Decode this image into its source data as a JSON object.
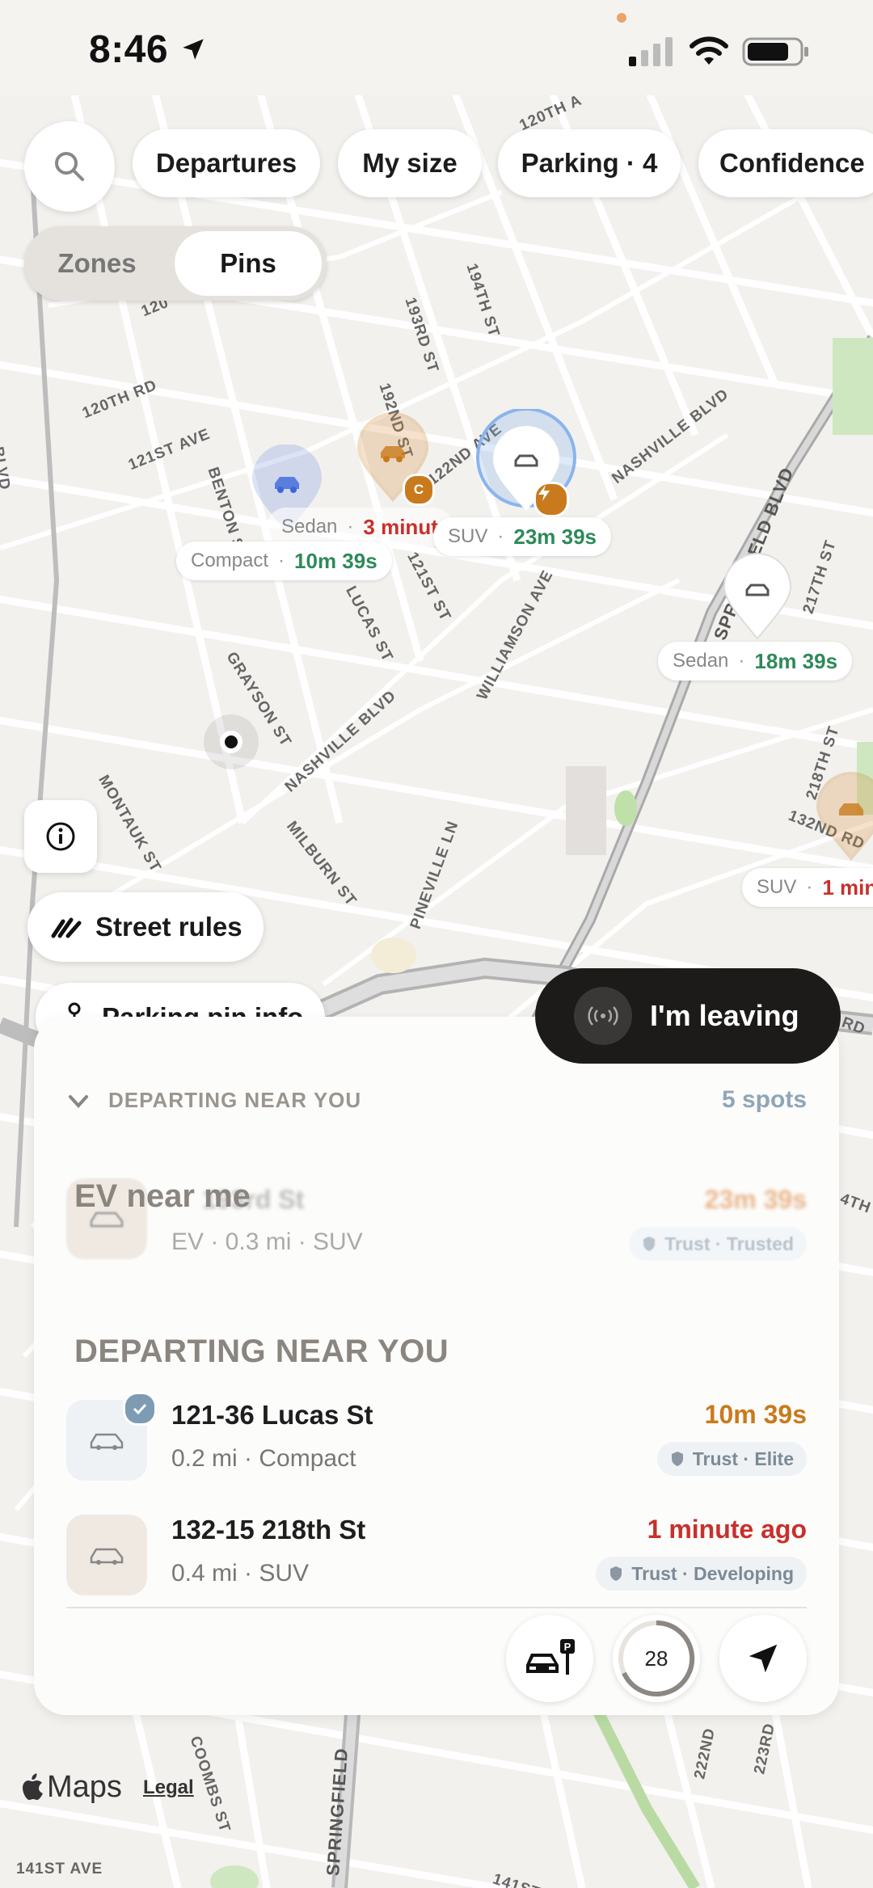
{
  "status_bar": {
    "time": "8:46"
  },
  "filters": {
    "departures": "Departures",
    "my_size": "My size",
    "parking": "Parking · 4",
    "confidence": "Confidence"
  },
  "view_toggle": {
    "zones": "Zones",
    "pins": "Pins",
    "selected": "Pins"
  },
  "streets": {
    "s1": "120TH RD",
    "s2": "121ST AVE",
    "s3": "BENTON ST",
    "s4": "193RD ST",
    "s5": "194TH ST",
    "s6": "192ND ST",
    "s7": "122ND AVE",
    "s8": "NASHVILLE BLVD",
    "s9": "SPRINGFIELD BLVD",
    "s10": "217TH ST",
    "s11": "LUCAS ST",
    "s12": "121ST ST",
    "s13": "WILLIAMSON AVE",
    "s14": "GRAYSON ST",
    "s15": "NASHVILLE BLVD",
    "s16": "MONTAUK ST",
    "s17": "MILBURN ST",
    "s18": "PINEVILLE LN",
    "s19": "218TH ST",
    "s20": "132ND RD",
    "s21": "120TH A",
    "s22": "141ST AVE",
    "s23": "COOMBS ST",
    "s24": "SPRINGFIELD",
    "s25": "222ND",
    "s26": "223RD",
    "s27": "141ST",
    "s28": "BLVD",
    "s29": "120",
    "s30": "RD",
    "s31": "4TH"
  },
  "pins": [
    {
      "vehicle": "Sedan",
      "time": "3 minut",
      "color": "#c8302c"
    },
    {
      "vehicle": "Compact",
      "time": "10m 39s",
      "color": "#2e8a5a"
    },
    {
      "vehicle": "SUV",
      "time": "23m 39s",
      "color": "#2e8a5a"
    },
    {
      "vehicle": "Sedan",
      "time": "18m 39s",
      "color": "#2e8a5a"
    },
    {
      "vehicle": "SUV",
      "time": "1 min",
      "color": "#c8302c"
    }
  ],
  "pin_badges": {
    "c_badge": "C"
  },
  "buttons": {
    "street_rules": "Street rules",
    "parking_pin_info": "Parking pin info",
    "leaving": "I'm leaving"
  },
  "sheet": {
    "section_header": "DEPARTING NEAR YOU",
    "spots": "5 spots",
    "ev_title": "EV near me",
    "ev_address_partial": "193rd St",
    "ev_time": "23m 39s",
    "ev_meta": "EV · 0.3 mi · SUV",
    "ev_trust": "Trust · Trusted",
    "list_header": "DEPARTING NEAR YOU",
    "items": [
      {
        "address": "121-36 Lucas St",
        "meta": "0.2 mi · Compact",
        "time": "10m 39s",
        "time_color": "#c97a1c",
        "trust": "Trust · Elite"
      },
      {
        "address": "132-15 218th St",
        "meta": "0.4 mi · SUV",
        "time": "1 minute ago",
        "time_color": "#c8302c",
        "trust": "Trust · Developing"
      }
    ],
    "counter": "28"
  },
  "attribution": {
    "maps": "Maps",
    "legal": "Legal"
  }
}
